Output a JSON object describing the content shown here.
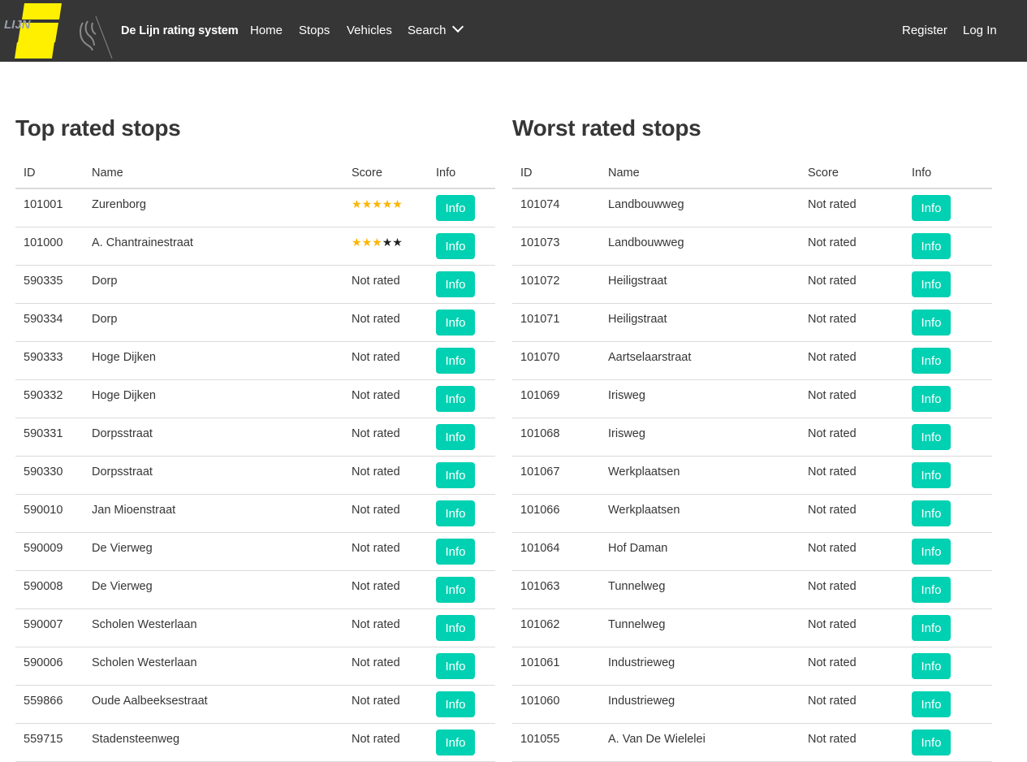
{
  "colors": {
    "navbar": "#363636",
    "accent": "#00d1b2",
    "star_filled": "#ffb400",
    "star_empty": "#222222",
    "logo_yellow": "#fff000"
  },
  "nav": {
    "logo_text": "LIJN",
    "brand": "De Lijn rating system",
    "home": "Home",
    "stops": "Stops",
    "vehicles": "Vehicles",
    "search": "Search",
    "register": "Register",
    "login": "Log In"
  },
  "top": {
    "title": "Top rated stops",
    "headers": {
      "id": "ID",
      "name": "Name",
      "score": "Score",
      "info": "Info"
    },
    "rows": [
      {
        "id": "101001",
        "name": "Zurenborg",
        "score": "",
        "rating": 5,
        "info": "Info"
      },
      {
        "id": "101000",
        "name": "A. Chantrainestraat",
        "score": "",
        "rating": 3,
        "info": "Info"
      },
      {
        "id": "590335",
        "name": "Dorp",
        "score": "Not rated",
        "info": "Info"
      },
      {
        "id": "590334",
        "name": "Dorp",
        "score": "Not rated",
        "info": "Info"
      },
      {
        "id": "590333",
        "name": "Hoge Dijken",
        "score": "Not rated",
        "info": "Info"
      },
      {
        "id": "590332",
        "name": "Hoge Dijken",
        "score": "Not rated",
        "info": "Info"
      },
      {
        "id": "590331",
        "name": "Dorpsstraat",
        "score": "Not rated",
        "info": "Info"
      },
      {
        "id": "590330",
        "name": "Dorpsstraat",
        "score": "Not rated",
        "info": "Info"
      },
      {
        "id": "590010",
        "name": "Jan Mioenstraat",
        "score": "Not rated",
        "info": "Info"
      },
      {
        "id": "590009",
        "name": "De Vierweg",
        "score": "Not rated",
        "info": "Info"
      },
      {
        "id": "590008",
        "name": "De Vierweg",
        "score": "Not rated",
        "info": "Info"
      },
      {
        "id": "590007",
        "name": "Scholen Westerlaan",
        "score": "Not rated",
        "info": "Info"
      },
      {
        "id": "590006",
        "name": "Scholen Westerlaan",
        "score": "Not rated",
        "info": "Info"
      },
      {
        "id": "559866",
        "name": "Oude Aalbeeksestraat",
        "score": "Not rated",
        "info": "Info"
      },
      {
        "id": "559715",
        "name": "Stadensteenweg",
        "score": "Not rated",
        "info": "Info"
      }
    ]
  },
  "worst": {
    "title": "Worst rated stops",
    "headers": {
      "id": "ID",
      "name": "Name",
      "score": "Score",
      "info": "Info"
    },
    "rows": [
      {
        "id": "101074",
        "name": "Landbouwweg",
        "score": "Not rated",
        "info": "Info"
      },
      {
        "id": "101073",
        "name": "Landbouwweg",
        "score": "Not rated",
        "info": "Info"
      },
      {
        "id": "101072",
        "name": "Heiligstraat",
        "score": "Not rated",
        "info": "Info"
      },
      {
        "id": "101071",
        "name": "Heiligstraat",
        "score": "Not rated",
        "info": "Info"
      },
      {
        "id": "101070",
        "name": "Aartselaarstraat",
        "score": "Not rated",
        "info": "Info"
      },
      {
        "id": "101069",
        "name": "Irisweg",
        "score": "Not rated",
        "info": "Info"
      },
      {
        "id": "101068",
        "name": "Irisweg",
        "score": "Not rated",
        "info": "Info"
      },
      {
        "id": "101067",
        "name": "Werkplaatsen",
        "score": "Not rated",
        "info": "Info"
      },
      {
        "id": "101066",
        "name": "Werkplaatsen",
        "score": "Not rated",
        "info": "Info"
      },
      {
        "id": "101064",
        "name": "Hof Daman",
        "score": "Not rated",
        "info": "Info"
      },
      {
        "id": "101063",
        "name": "Tunnelweg",
        "score": "Not rated",
        "info": "Info"
      },
      {
        "id": "101062",
        "name": "Tunnelweg",
        "score": "Not rated",
        "info": "Info"
      },
      {
        "id": "101061",
        "name": "Industrieweg",
        "score": "Not rated",
        "info": "Info"
      },
      {
        "id": "101060",
        "name": "Industrieweg",
        "score": "Not rated",
        "info": "Info"
      },
      {
        "id": "101055",
        "name": "A. Van De Wielelei",
        "score": "Not rated",
        "info": "Info"
      }
    ]
  }
}
